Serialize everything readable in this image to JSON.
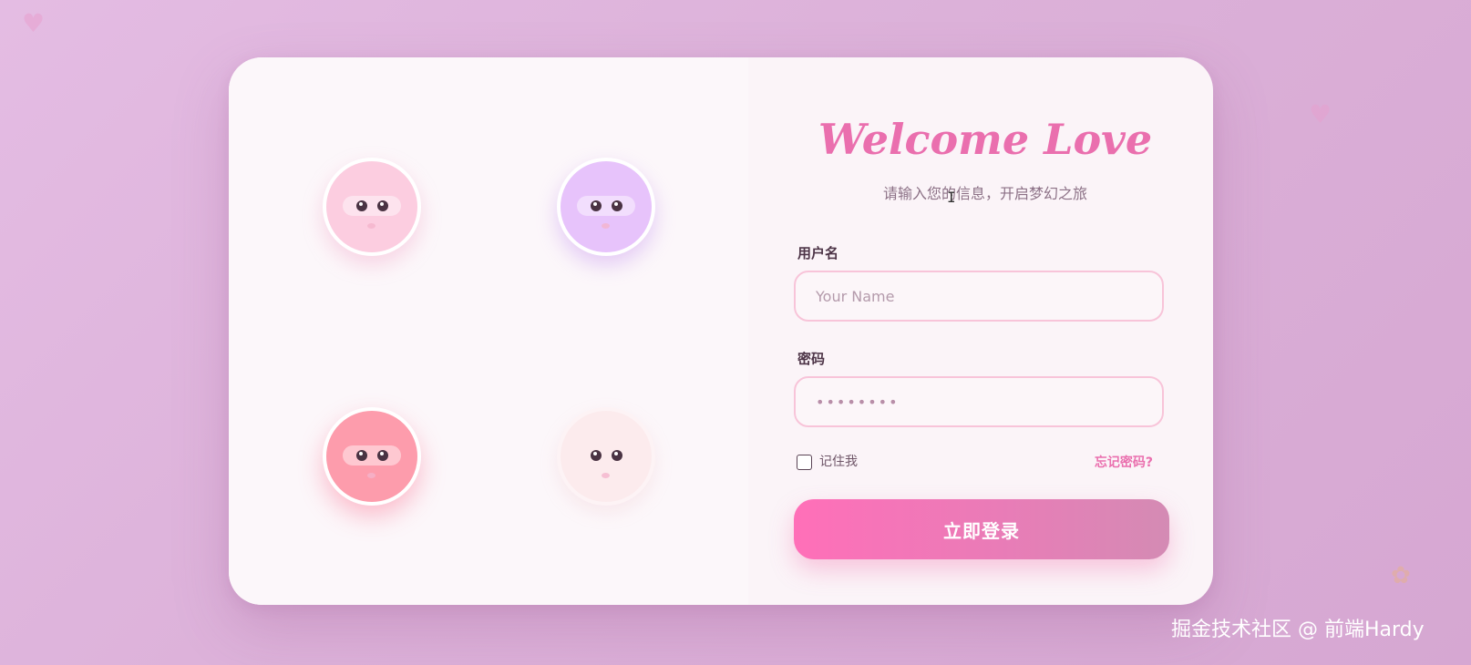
{
  "decorations": {
    "heart_glyph": "♥",
    "flower_glyph": "✿",
    "cursor_glyph": "I"
  },
  "login": {
    "title": "Welcome Love",
    "subtitle": "请输入您的信息，开启梦幻之旅",
    "username": {
      "label": "用户名",
      "placeholder": "Your Name",
      "value": ""
    },
    "password": {
      "label": "密码",
      "value": "••••••••"
    },
    "remember_label": "记住我",
    "remember_checked": false,
    "forgot_label": "忘记密码?",
    "submit_label": "立即登录"
  },
  "avatars": [
    {
      "name": "pink",
      "color": "#fccde0"
    },
    {
      "name": "lavender",
      "color": "#e7c3fb"
    },
    {
      "name": "coral",
      "color": "#fd9cac"
    },
    {
      "name": "cream",
      "color": "#fcebed"
    }
  ],
  "colors": {
    "accent": "#ea6fae",
    "background": "#dcb1d9"
  },
  "watermark": "掘金技术社区 @ 前端Hardy"
}
